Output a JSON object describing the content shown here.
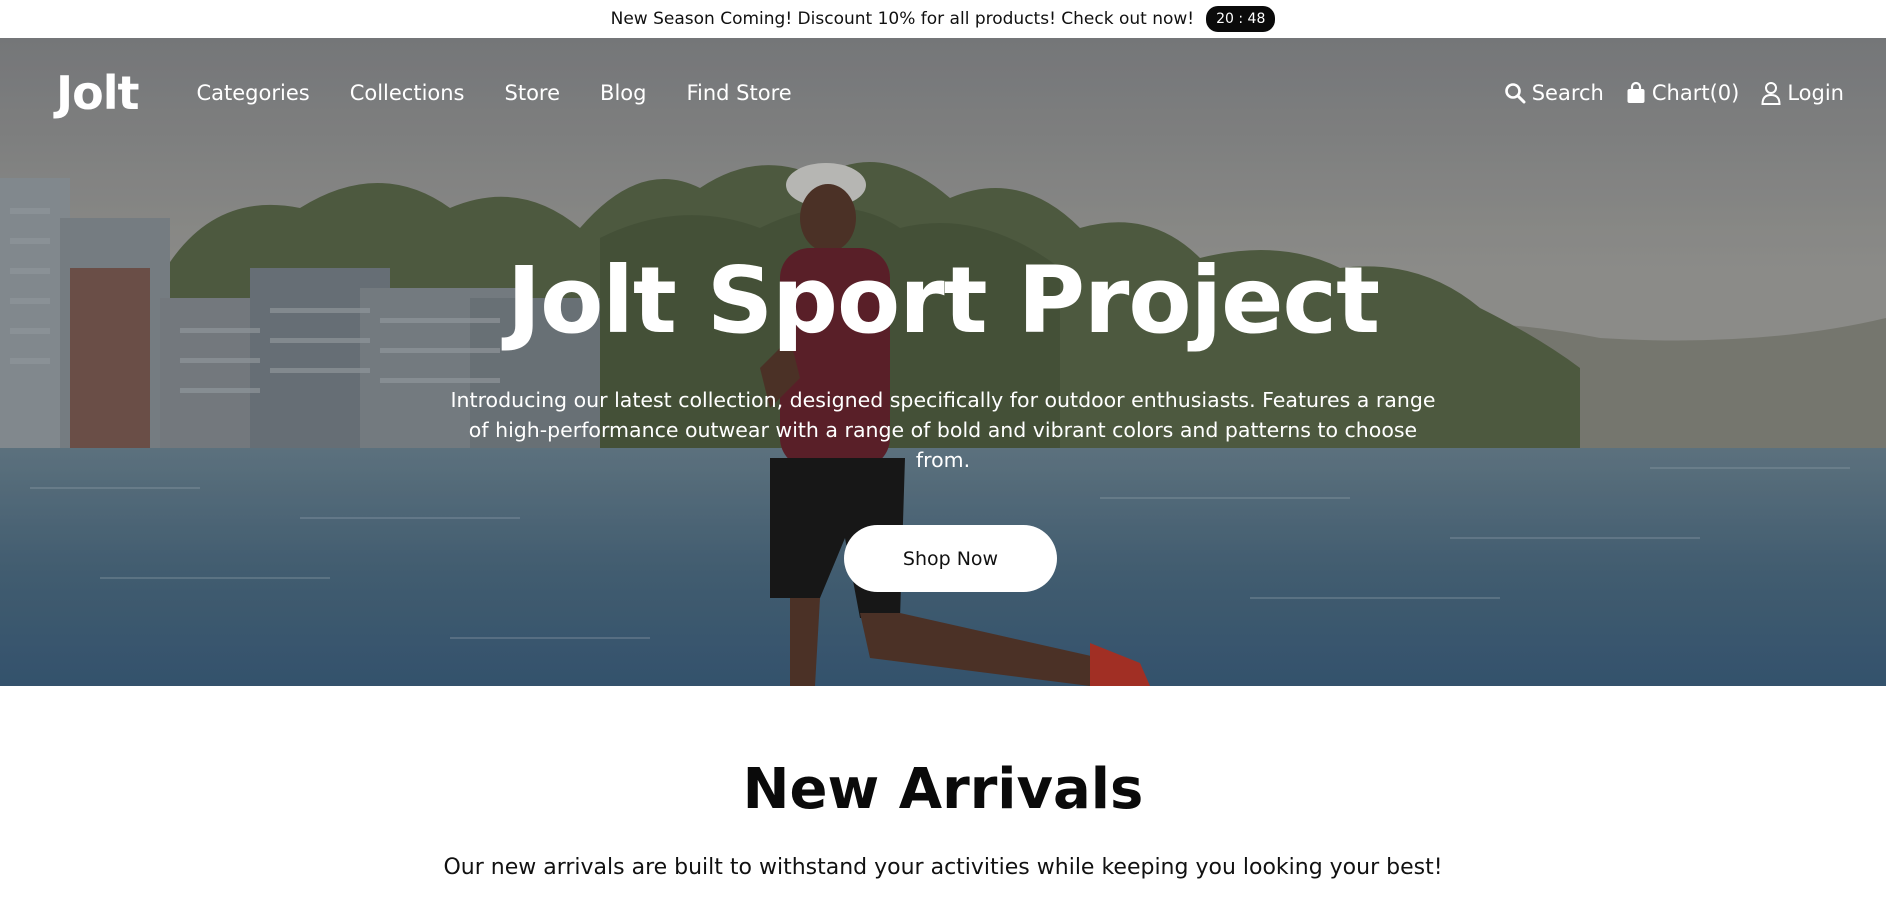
{
  "announcement": {
    "text": "New Season Coming! Discount 10% for all products! Check out now!",
    "timer": "20 : 48"
  },
  "nav": {
    "logo": "Jolt",
    "links": [
      "Categories",
      "Collections",
      "Store",
      "Blog",
      "Find Store"
    ],
    "search_label": "Search",
    "cart_label": "Chart(0)",
    "login_label": "Login"
  },
  "hero": {
    "title": "Jolt Sport Project",
    "subtitle": "Introducing our latest collection, designed specifically for outdoor enthusiasts. Features a range of high-performance outwear with a range of bold and vibrant colors and patterns to choose from.",
    "cta_label": "Shop Now"
  },
  "new_arrivals": {
    "title": "New Arrivals",
    "subtitle": "Our new arrivals are built to withstand your activities while keeping you looking your best!"
  },
  "icons": {
    "search": "search-icon",
    "cart": "shopping-bag-icon",
    "login": "user-icon"
  },
  "colors": {
    "timer_bg": "#0a0a0a",
    "cta_bg": "#ffffff",
    "text_on_hero": "#ffffff"
  }
}
